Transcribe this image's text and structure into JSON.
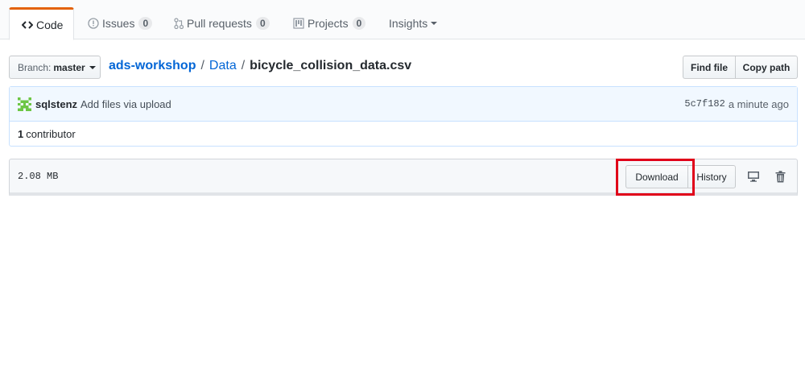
{
  "tabs": [
    {
      "label": "Code",
      "icon": "code-icon",
      "selected": true
    },
    {
      "label": "Issues",
      "count": "0",
      "icon": "issue-icon"
    },
    {
      "label": "Pull requests",
      "count": "0",
      "icon": "pull-request-icon"
    },
    {
      "label": "Projects",
      "count": "0",
      "icon": "project-icon"
    },
    {
      "label": "Insights",
      "icon": "chevron-down-icon"
    }
  ],
  "branch": {
    "prefix": "Branch:",
    "name": "master"
  },
  "breadcrumb": {
    "repo": "ads-workshop",
    "sep1": "/",
    "folder": "Data",
    "sep2": "/",
    "file": "bicycle_collision_data.csv"
  },
  "file_actions": {
    "find_file": "Find file",
    "copy_path": "Copy path"
  },
  "commit": {
    "author": "sqlstenz",
    "message": "Add files via upload",
    "sha": "5c7f182",
    "time": "a minute ago"
  },
  "contributors": {
    "count": "1",
    "label": "contributor"
  },
  "file": {
    "size": "2.08 MB",
    "download": "Download",
    "history": "History"
  },
  "colors": {
    "accent": "#e36209",
    "link": "#0366d6",
    "highlight": "#e00019"
  }
}
